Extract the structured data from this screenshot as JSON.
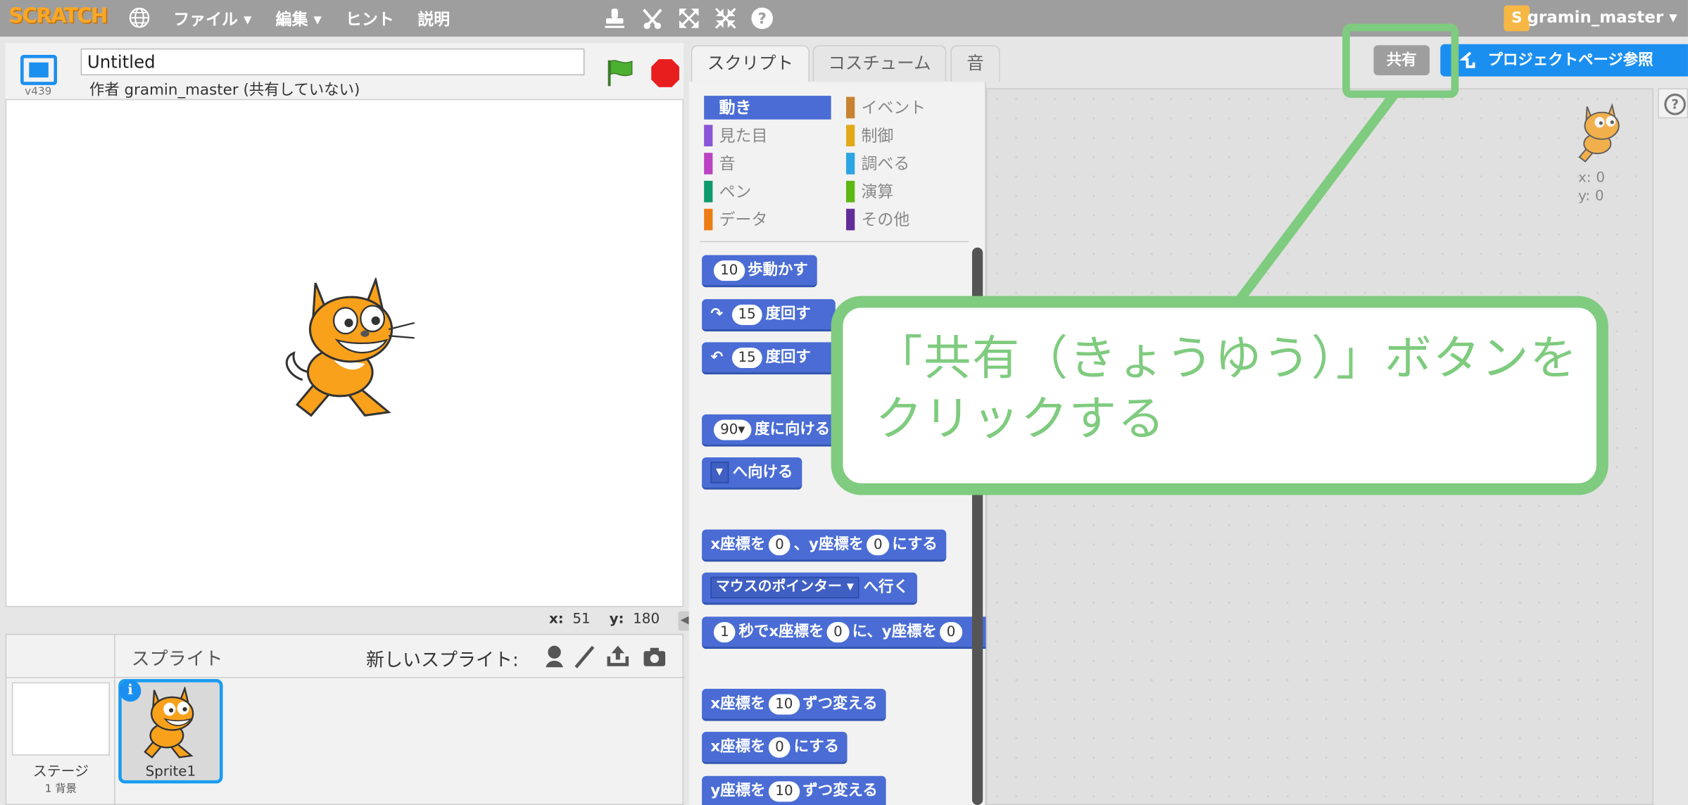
{
  "topbar": {
    "logo": "SCRATCH",
    "menu": [
      "ファイル ▾",
      "編集 ▾",
      "ヒント",
      "説明"
    ],
    "tools": [
      "stamp-icon",
      "scissors-icon",
      "grow-icon",
      "shrink-icon",
      "help-icon"
    ],
    "username": "gramin_master ▾",
    "user_badge": "S"
  },
  "stage_header": {
    "version": "v439",
    "title_value": "Untitled",
    "author": "作者 gramin_master (共有していない)"
  },
  "stage": {
    "coords": {
      "x_label": "x:",
      "x_value": "51",
      "y_label": "y:",
      "y_value": "180"
    }
  },
  "sprite_panel": {
    "label": "スプライト",
    "new_sprite_label": "新しいスプライト:",
    "stage_label": "ステージ",
    "stage_sub": "1 背景",
    "sprite_name": "Sprite1",
    "info_badge": "i"
  },
  "tabs": [
    "スクリプト",
    "コスチューム",
    "音"
  ],
  "header_buttons": {
    "share": "共有",
    "project_page": "プロジェクトページ参照"
  },
  "categories": {
    "left": [
      {
        "label": "動き",
        "color": "#4a6cd4"
      },
      {
        "label": "見た目",
        "color": "#8a55d7"
      },
      {
        "label": "音",
        "color": "#bb42c3"
      },
      {
        "label": "ペン",
        "color": "#0e9a6c"
      },
      {
        "label": "データ",
        "color": "#ee7d16"
      }
    ],
    "right": [
      {
        "label": "イベント",
        "color": "#c88330"
      },
      {
        "label": "制御",
        "color": "#e1a91a"
      },
      {
        "label": "調べる",
        "color": "#2ca5e2"
      },
      {
        "label": "演算",
        "color": "#5cb712"
      },
      {
        "label": "その他",
        "color": "#632d99"
      }
    ]
  },
  "blocks": {
    "move": {
      "n": "10",
      "text": "歩動かす"
    },
    "turn_right": {
      "n": "15",
      "text": "度回す"
    },
    "turn_left": {
      "n": "15",
      "text": "度回す"
    },
    "point_dir": {
      "n": "90▾",
      "text": "度に向ける"
    },
    "point_towards": {
      "dd": "▾",
      "text": "へ向ける"
    },
    "goto_xy": {
      "a": "x座標を",
      "x": "0",
      "b": "、y座標を",
      "y": "0",
      "c": "にする"
    },
    "goto": {
      "dd": "マウスのポインター ▾",
      "text": "へ行く"
    },
    "glide": {
      "n": "1",
      "a": "秒でx座標を",
      "x": "0",
      "b": "に、y座標を",
      "y": "0"
    },
    "change_x": {
      "a": "x座標を",
      "n": "10",
      "b": "ずつ変える"
    },
    "set_x": {
      "a": "x座標を",
      "n": "0",
      "b": "にする"
    },
    "change_y": {
      "a": "y座標を",
      "n": "10",
      "b": "ずつ変える"
    }
  },
  "script_area": {
    "x_label": "x:",
    "x_value": "0",
    "y_label": "y:",
    "y_value": "0",
    "help": "?"
  },
  "callout": {
    "line1": "「共有（きょうゆう）」ボタンを",
    "line2": "クリックする",
    "color": "#7fcb7f"
  }
}
